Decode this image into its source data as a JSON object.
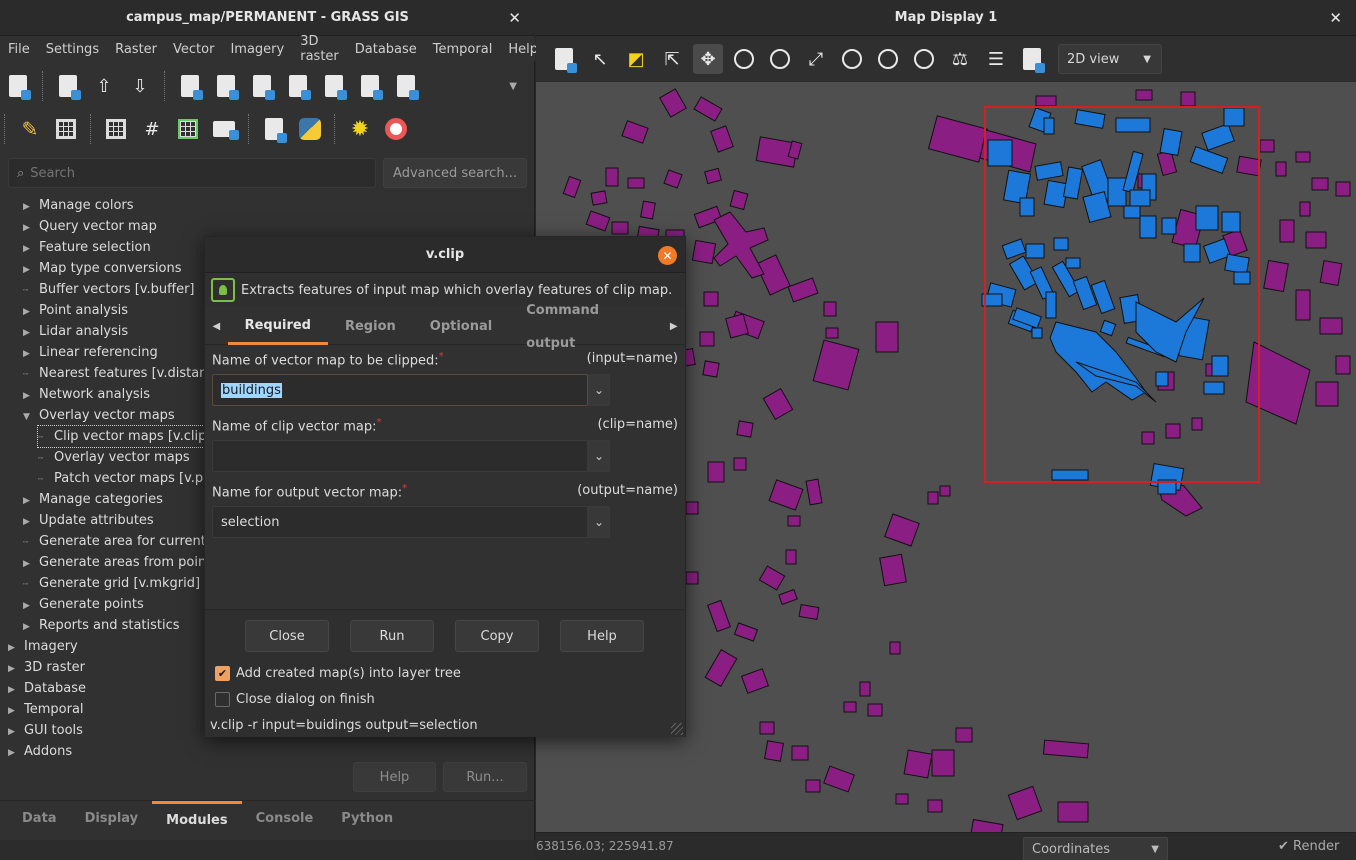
{
  "main_window": {
    "title": "campus_map/PERMANENT - GRASS GIS",
    "close": "✕",
    "menu": [
      "File",
      "Settings",
      "Raster",
      "Vector",
      "Imagery",
      "3D raster",
      "Database",
      "Temporal",
      "Help"
    ],
    "search": {
      "placeholder": "Search"
    },
    "advanced_search": "Advanced search...",
    "tree": [
      {
        "label": "Manage colors",
        "level": 2,
        "expandable": true
      },
      {
        "label": "Query vector map",
        "level": 2,
        "expandable": true
      },
      {
        "label": "Feature selection",
        "level": 2,
        "expandable": true
      },
      {
        "label": "Map type conversions",
        "level": 2,
        "expandable": true
      },
      {
        "label": "Buffer vectors   [v.buffer]",
        "level": 2,
        "expandable": false
      },
      {
        "label": "Point analysis",
        "level": 2,
        "expandable": true
      },
      {
        "label": "Lidar analysis",
        "level": 2,
        "expandable": true
      },
      {
        "label": "Linear referencing",
        "level": 2,
        "expandable": true
      },
      {
        "label": "Nearest features   [v.distance]",
        "level": 2,
        "expandable": false
      },
      {
        "label": "Network analysis",
        "level": 2,
        "expandable": true
      },
      {
        "label": "Overlay vector maps",
        "level": 2,
        "expandable": true,
        "expanded": true
      },
      {
        "label": "Clip vector maps   [v.clip]",
        "level": 3,
        "expandable": false,
        "selected": true
      },
      {
        "label": "Overlay vector maps",
        "level": 3,
        "expandable": false
      },
      {
        "label": "Patch vector maps   [v.patch]",
        "level": 3,
        "expandable": false
      },
      {
        "label": "Manage categories",
        "level": 2,
        "expandable": true
      },
      {
        "label": "Update attributes",
        "level": 2,
        "expandable": true
      },
      {
        "label": "Generate area for current region",
        "level": 2,
        "expandable": false
      },
      {
        "label": "Generate areas from points",
        "level": 2,
        "expandable": true
      },
      {
        "label": "Generate grid   [v.mkgrid]",
        "level": 2,
        "expandable": false
      },
      {
        "label": "Generate points",
        "level": 2,
        "expandable": true
      },
      {
        "label": "Reports and statistics",
        "level": 2,
        "expandable": true
      },
      {
        "label": "Imagery",
        "level": 1,
        "expandable": true
      },
      {
        "label": "3D raster",
        "level": 1,
        "expandable": true
      },
      {
        "label": "Database",
        "level": 1,
        "expandable": true
      },
      {
        "label": "Temporal",
        "level": 1,
        "expandable": true
      },
      {
        "label": "GUI tools",
        "level": 1,
        "expandable": true
      },
      {
        "label": "Addons",
        "level": 1,
        "expandable": true
      }
    ],
    "help_button": "Help",
    "run_button": "Run...",
    "bottom_tabs": [
      "Data",
      "Display",
      "Modules",
      "Console",
      "Python"
    ],
    "active_tab": "Modules"
  },
  "map_window": {
    "title": "Map Display 1",
    "close": "✕",
    "view_mode": "2D view",
    "coords": "638156.03; 225941.87",
    "coord_mode": "Coordinates",
    "render": "✔ Render"
  },
  "dialog": {
    "title": "v.clip",
    "description": "Extracts features of input map which overlay features of clip map.",
    "tabs": [
      "Required",
      "Region",
      "Optional",
      "Command output"
    ],
    "active_tab": "Required",
    "fields": [
      {
        "label": "Name of vector map to be clipped:",
        "param": "(input=name)",
        "value": "buildings"
      },
      {
        "label": "Name of clip vector map:",
        "param": "(clip=name)",
        "value": ""
      },
      {
        "label": "Name for output vector map:",
        "param": "(output=name)",
        "value": "selection"
      }
    ],
    "buttons": [
      "Close",
      "Run",
      "Copy",
      "Help"
    ],
    "checkbox_add": {
      "label": "Add created map(s) into layer tree",
      "checked": true
    },
    "checkbox_close": {
      "label": "Close dialog on finish",
      "checked": false
    },
    "command": "v.clip -r input=buidings output=selection"
  },
  "colors": {
    "buildings_fill": "#8a1e82",
    "selected_fill": "#1d79d9",
    "clip_box": "#d42020",
    "accent": "#f08a3a"
  }
}
